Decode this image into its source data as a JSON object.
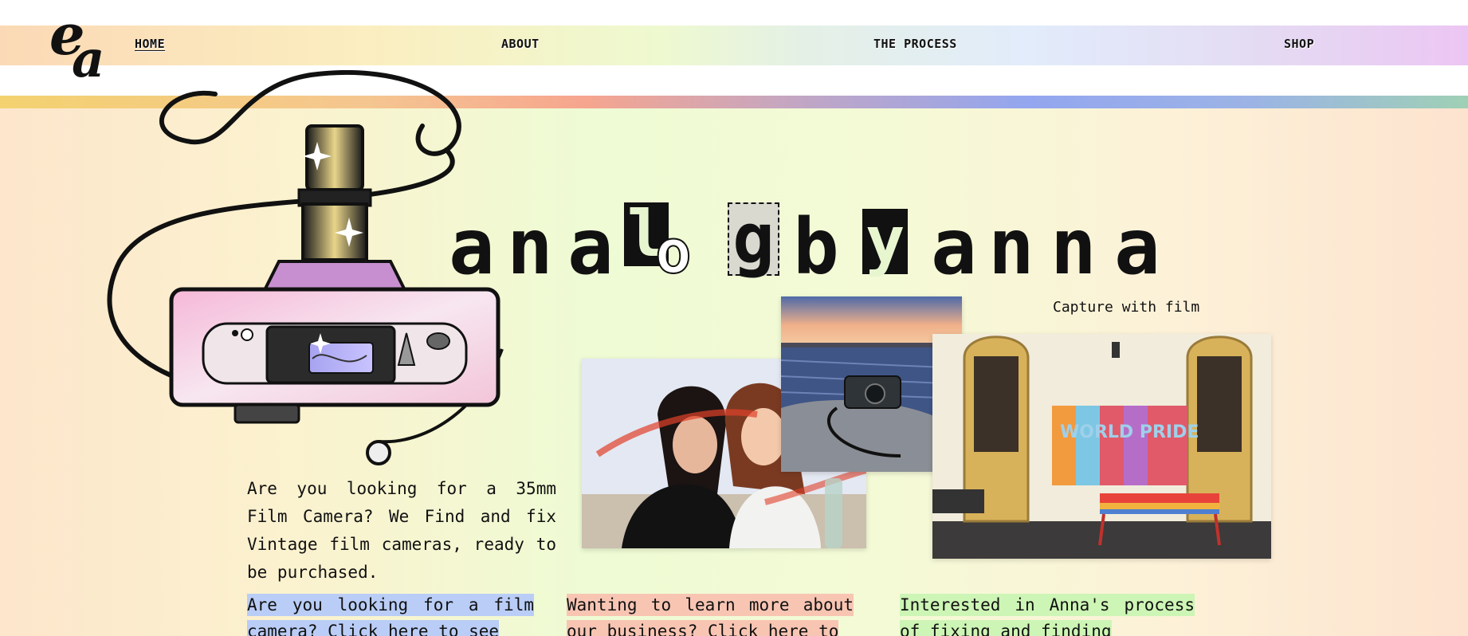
{
  "logo": {
    "text": "ea",
    "alt": "ea monogram logo"
  },
  "nav": {
    "home": "HOME",
    "about": "ABOUT",
    "process": "THE PROCESS",
    "shop": "SHOP"
  },
  "hero": {
    "title_glyphs": [
      "a",
      "n",
      "a",
      "l",
      "o",
      "g",
      "b",
      "y",
      "a",
      "n",
      "n",
      "a"
    ],
    "caption": "Capture with film"
  },
  "intro": {
    "text": "Are you looking for a 35mm Film Camera? We Find and fix Vintage film cameras, ready to be purchased."
  },
  "cta": {
    "shop_text": "Are you looking for a film camera? Click here to see",
    "about_text": "Wanting to learn more about our business? Click here to",
    "process_text": "Interested in Anna's process of fixing and finding"
  },
  "wall_sign": "WORLD PRIDE",
  "colors": {
    "shop_highlight": "#b9cdf6",
    "about_highlight": "#f8c5b3",
    "process_highlight": "#cdf5b5"
  }
}
